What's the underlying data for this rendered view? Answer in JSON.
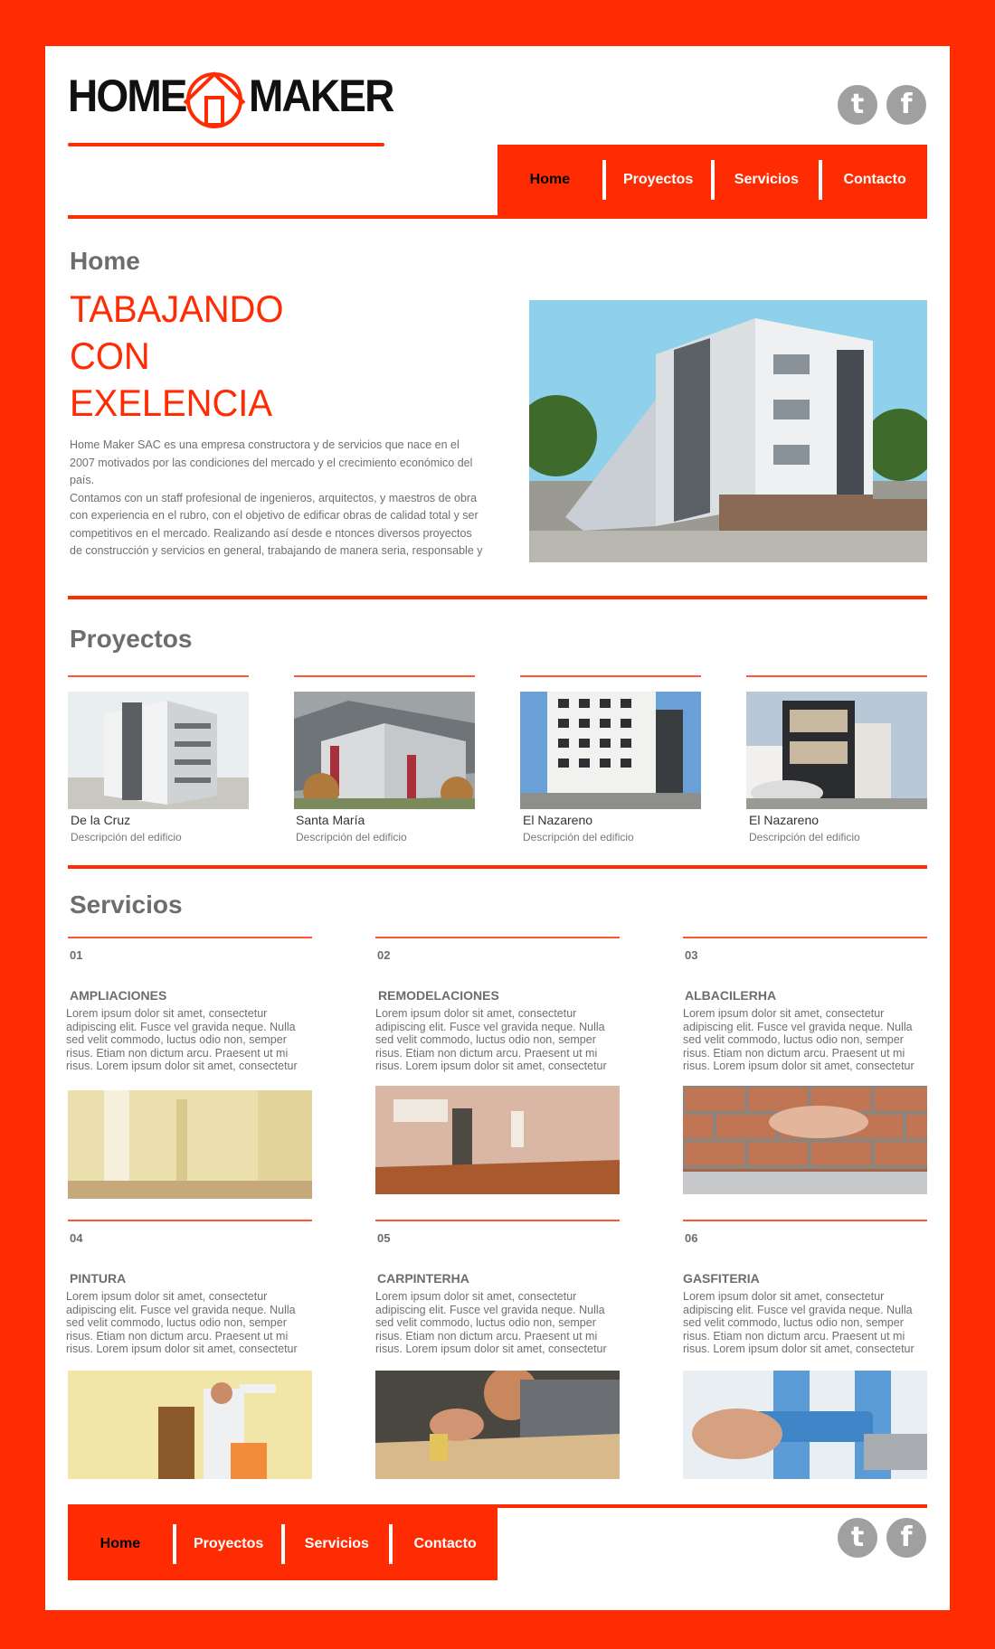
{
  "brand": {
    "logo_part1": "HOME",
    "logo_part2": "MAKER"
  },
  "social": {
    "twitter_glyph": "t",
    "facebook_glyph": "f"
  },
  "nav": {
    "items": [
      "Home",
      "Proyectos",
      "Servicios",
      "Contacto"
    ],
    "active": "Home"
  },
  "home": {
    "heading": "Home",
    "title_lines": [
      "TABAJANDO",
      "CON",
      "EXELENCIA"
    ],
    "paragraph_lines": [
      "Home Maker SAC es una empresa constructora y de servicios que nace  en el",
      "2007 motivados por las condiciones del mercado y el crecimiento  económico del",
      "país.",
      "Contamos con un staff profesional de ingenieros, arquitectos, y maestros de obra",
      "con experiencia en el rubro, con el objetivo de edificar obras de calidad total y ser",
      "competitivos en el mercado. Realizando así desde e ntonces diversos proyectos",
      "de construcción y servicios en general, trabajando de manera seria, responsable y"
    ]
  },
  "proyectos": {
    "heading": "Proyectos",
    "items": [
      {
        "name": "De la Cruz",
        "desc": "Descripción del edificio"
      },
      {
        "name": "Santa María",
        "desc": "Descripción del edificio"
      },
      {
        "name": "El Nazareno",
        "desc": "Descripción del edificio"
      },
      {
        "name": "El Nazareno",
        "desc": "Descripción del edificio"
      }
    ]
  },
  "servicios": {
    "heading": "Servicios",
    "text_lines": [
      "Lorem ipsum dolor sit amet, consectetur",
      "adipiscing elit. Fusce vel gravida neque. Nulla",
      "sed velit commodo, luctus odio non, semper",
      "risus. Etiam non dictum arcu. Praesent ut mi",
      "risus. Lorem ipsum dolor sit amet, consectetur"
    ],
    "items": [
      {
        "num": "01",
        "title": "AMPLIACIONES"
      },
      {
        "num": "02",
        "title": "REMODELACIONES"
      },
      {
        "num": "03",
        "title": "ALBACILERHA"
      },
      {
        "num": "04",
        "title": "PINTURA"
      },
      {
        "num": "05",
        "title": "CARPINTERHA"
      },
      {
        "num": "06",
        "title": "GASFITERIA"
      }
    ]
  },
  "colors": {
    "accent": "#ff2c03",
    "text_gray": "#6d6d6d",
    "social_gray": "#a0a0a0"
  }
}
